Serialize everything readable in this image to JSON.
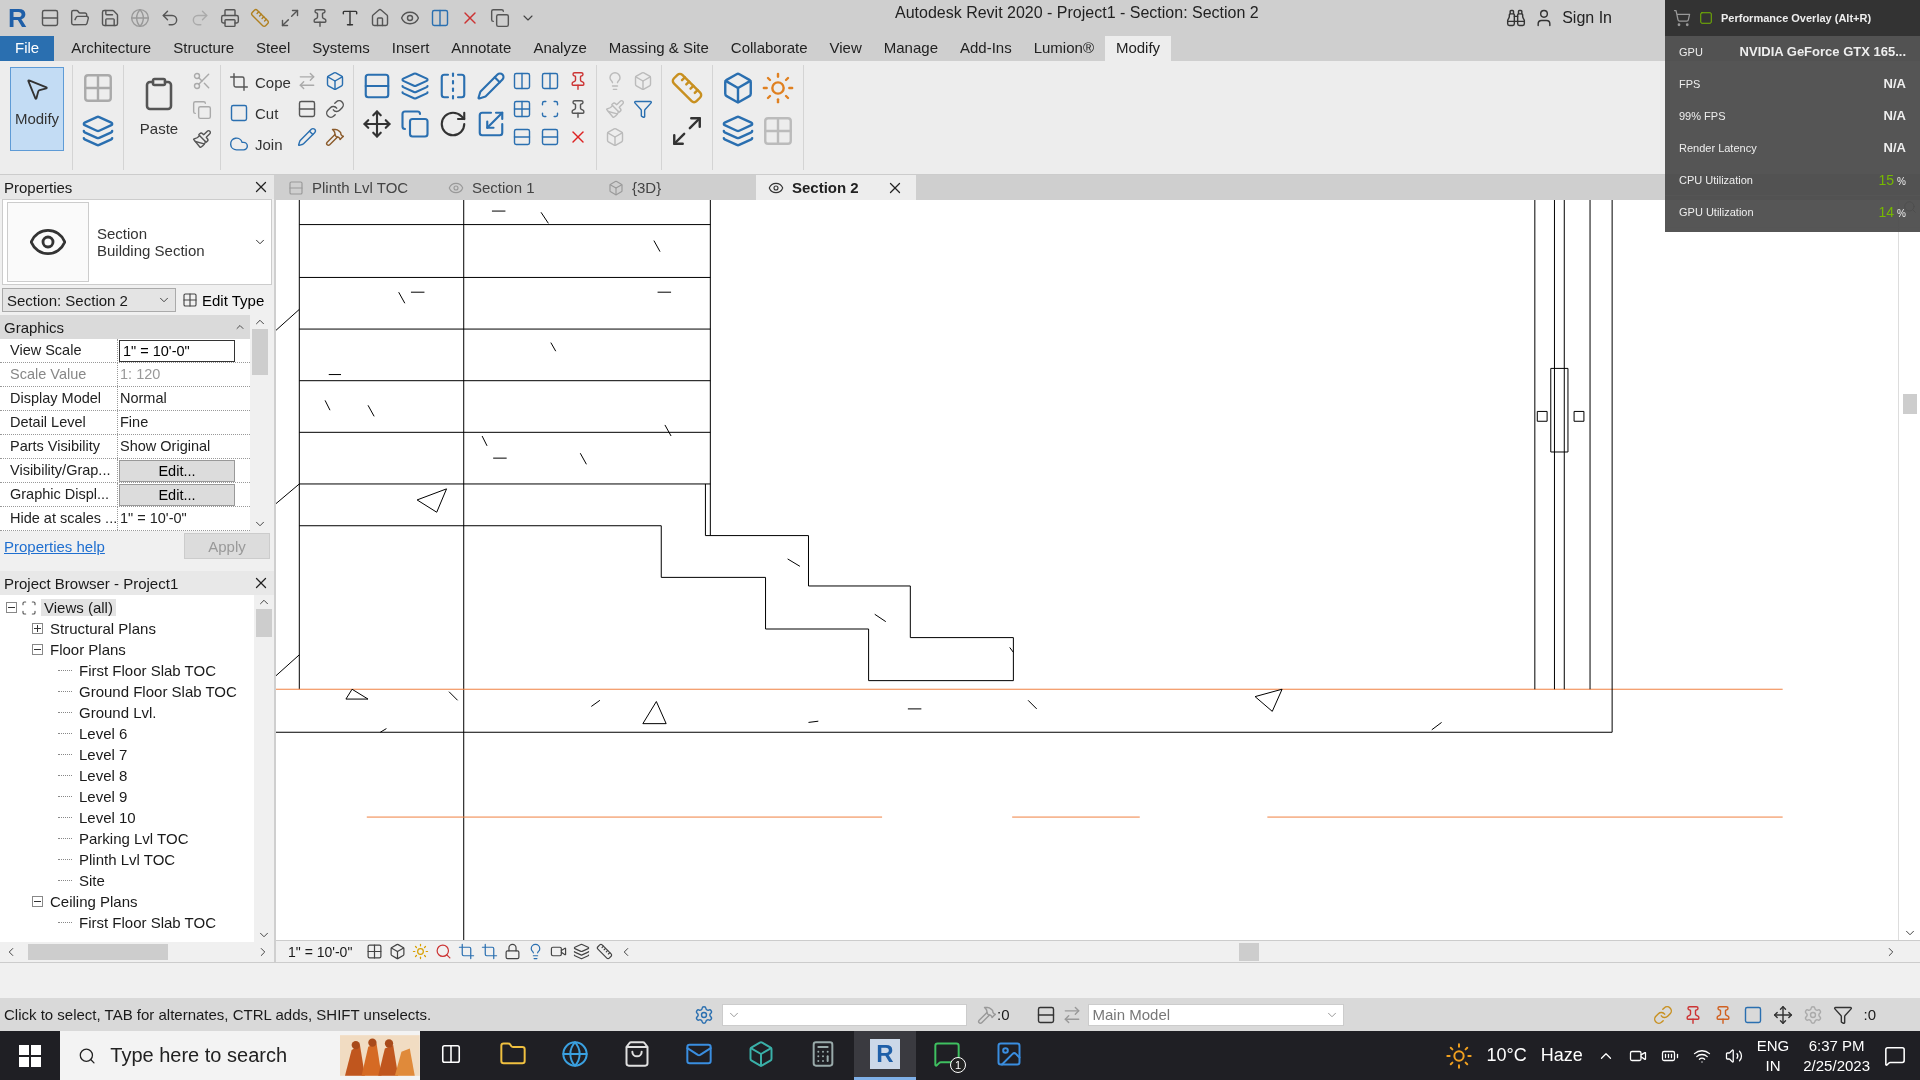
{
  "logo": "R",
  "window": {
    "title": "Autodesk Revit 2020 - Project1 - Section: Section 2"
  },
  "account": {
    "sign_in": "Sign In"
  },
  "ribbon_tabs": [
    {
      "label": "File",
      "selected": false,
      "kind": "file"
    },
    {
      "label": "Architecture",
      "selected": false,
      "kind": "tab"
    },
    {
      "label": "Structure",
      "selected": false,
      "kind": "tab"
    },
    {
      "label": "Steel",
      "selected": false,
      "kind": "tab"
    },
    {
      "label": "Systems",
      "selected": false,
      "kind": "tab"
    },
    {
      "label": "Insert",
      "selected": false,
      "kind": "tab"
    },
    {
      "label": "Annotate",
      "selected": false,
      "kind": "tab"
    },
    {
      "label": "Analyze",
      "selected": false,
      "kind": "tab"
    },
    {
      "label": "Massing & Site",
      "selected": false,
      "kind": "tab"
    },
    {
      "label": "Collaborate",
      "selected": false,
      "kind": "tab"
    },
    {
      "label": "View",
      "selected": false,
      "kind": "tab"
    },
    {
      "label": "Manage",
      "selected": false,
      "kind": "tab"
    },
    {
      "label": "Add-Ins",
      "selected": false,
      "kind": "tab"
    },
    {
      "label": "Lumion®",
      "selected": false,
      "kind": "tab"
    },
    {
      "label": "Modify",
      "selected": true,
      "kind": "tab"
    }
  ],
  "ribbon_tools": {
    "modify": "Modify",
    "paste": "Paste",
    "cope": "Cope",
    "cut": "Cut",
    "join": "Join"
  },
  "view_tabs": [
    {
      "label": "Plinth Lvl TOC",
      "selected": false,
      "kind": "plan"
    },
    {
      "label": "Section 1",
      "selected": false,
      "kind": "section"
    },
    {
      "label": "{3D}",
      "selected": false,
      "kind": "model"
    },
    {
      "label": "Section 2",
      "selected": true,
      "kind": "section"
    }
  ],
  "properties": {
    "title": "Properties",
    "type_name": "Section",
    "type_family": "Building Section",
    "selector": "Section: Section 2",
    "edit_type": "Edit Type",
    "group": "Graphics",
    "rows": [
      {
        "name": "View Scale",
        "value": "1\" = 10'-0\"",
        "kind": "input"
      },
      {
        "name": "Scale Value",
        "prefix": "1:",
        "value": "120",
        "kind": "disabled"
      },
      {
        "name": "Display Model",
        "value": "Normal",
        "kind": "text"
      },
      {
        "name": "Detail Level",
        "value": "Fine",
        "kind": "text"
      },
      {
        "name": "Parts Visibility",
        "value": "Show Original",
        "kind": "text"
      },
      {
        "name": "Visibility/Grap...",
        "value": "Edit...",
        "kind": "button"
      },
      {
        "name": "Graphic Displ...",
        "value": "Edit...",
        "kind": "button"
      },
      {
        "name": "Hide at scales ...",
        "value": "1\" = 10'-0\"",
        "kind": "text"
      }
    ],
    "help": "Properties help",
    "apply": "Apply"
  },
  "project_browser": {
    "title": "Project Browser - Project1",
    "tree": [
      {
        "label": "Views (all)",
        "expanded": true,
        "selected": true,
        "children": [
          {
            "label": "Structural Plans",
            "expanded": false,
            "selected": false
          },
          {
            "label": "Floor Plans",
            "expanded": true,
            "selected": false,
            "children": [
              {
                "label": "First Floor Slab TOC",
                "selected": false
              },
              {
                "label": "Ground Floor Slab TOC",
                "selected": false
              },
              {
                "label": "Ground Lvl.",
                "selected": false
              },
              {
                "label": "Level 6",
                "selected": false
              },
              {
                "label": "Level 7",
                "selected": false
              },
              {
                "label": "Level 8",
                "selected": false
              },
              {
                "label": "Level 9",
                "selected": false
              },
              {
                "label": "Level 10",
                "selected": false
              },
              {
                "label": "Parking Lvl TOC",
                "selected": false
              },
              {
                "label": "Plinth Lvl TOC",
                "selected": false
              },
              {
                "label": "Site",
                "selected": false
              }
            ]
          },
          {
            "label": "Ceiling Plans",
            "expanded": true,
            "selected": false,
            "children": [
              {
                "label": "First Floor Slab TOC",
                "selected": false
              }
            ]
          }
        ]
      }
    ]
  },
  "view_control": {
    "scale": "1\" = 10'-0\""
  },
  "status_bar": {
    "message": "Click to select, TAB for alternates, CTRL adds, SHIFT unselects.",
    "worksets_count": ":0",
    "model": "Main Model",
    "filter_count": ":0"
  },
  "taskbar": {
    "search_placeholder": "Type here to search",
    "revit_letter": "R",
    "whatsapp_badge": "1",
    "temperature": "10°C",
    "weather": "Haze",
    "lang": "ENG",
    "region": "IN",
    "time": "6:37 PM",
    "date": "2/25/2023"
  },
  "overlay": {
    "title": "Performance Overlay (Alt+R)",
    "rows": [
      {
        "label": "GPU",
        "value": "NVIDIA GeForce GTX 165...",
        "kind": "text"
      },
      {
        "label": "FPS",
        "value": "N/A",
        "kind": "text"
      },
      {
        "label": "99% FPS",
        "value": "N/A",
        "kind": "text"
      },
      {
        "label": "Render Latency",
        "value": "N/A",
        "kind": "text"
      },
      {
        "label": "CPU Utilization",
        "value": "15",
        "unit": "%",
        "kind": "percent"
      },
      {
        "label": "GPU Utilization",
        "value": "14",
        "unit": "%",
        "kind": "percent"
      }
    ]
  }
}
